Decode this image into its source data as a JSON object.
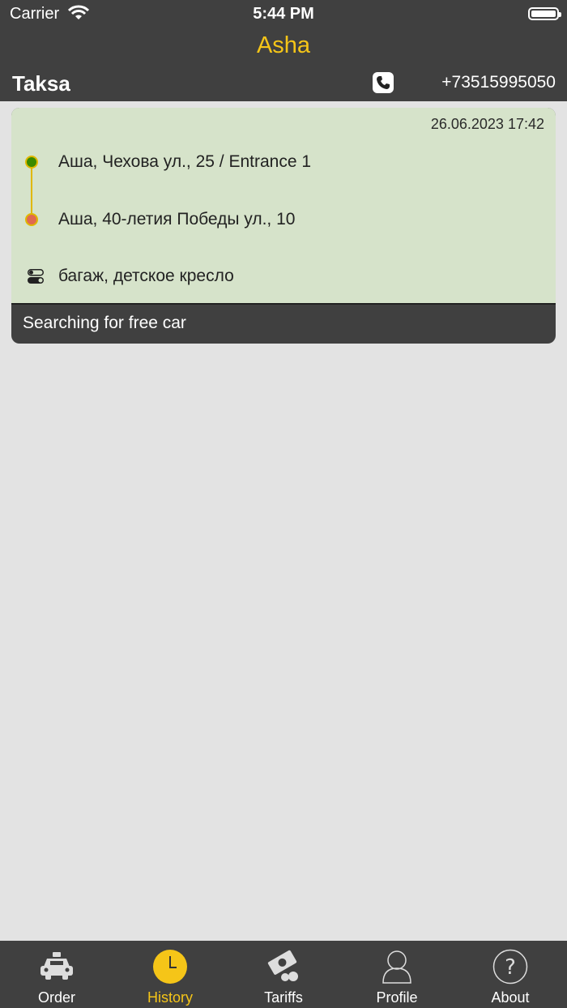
{
  "status_bar": {
    "carrier": "Carrier",
    "time": "5:44 PM"
  },
  "header": {
    "title": "Asha"
  },
  "sub_header": {
    "brand": "Taksa",
    "phone": "+73515995050"
  },
  "order": {
    "date": "26.06.2023 17:42",
    "from": "Аша, Чехова ул., 25 / Entrance 1",
    "to": "Аша, 40-летия Победы ул., 10",
    "options": "багаж, детское кресло",
    "status": "Searching for free car"
  },
  "tabs": [
    {
      "label": "Order",
      "icon": "taxi-icon",
      "active": false
    },
    {
      "label": "History",
      "icon": "clock-icon",
      "active": true
    },
    {
      "label": "Tariffs",
      "icon": "money-icon",
      "active": false
    },
    {
      "label": "Profile",
      "icon": "person-icon",
      "active": false
    },
    {
      "label": "About",
      "icon": "question-icon",
      "active": false
    }
  ],
  "colors": {
    "accent": "#f5c518",
    "bar": "#404040",
    "card": "#d6e3ca",
    "from_dot": "#3a8a00",
    "to_dot": "#e06a50"
  }
}
